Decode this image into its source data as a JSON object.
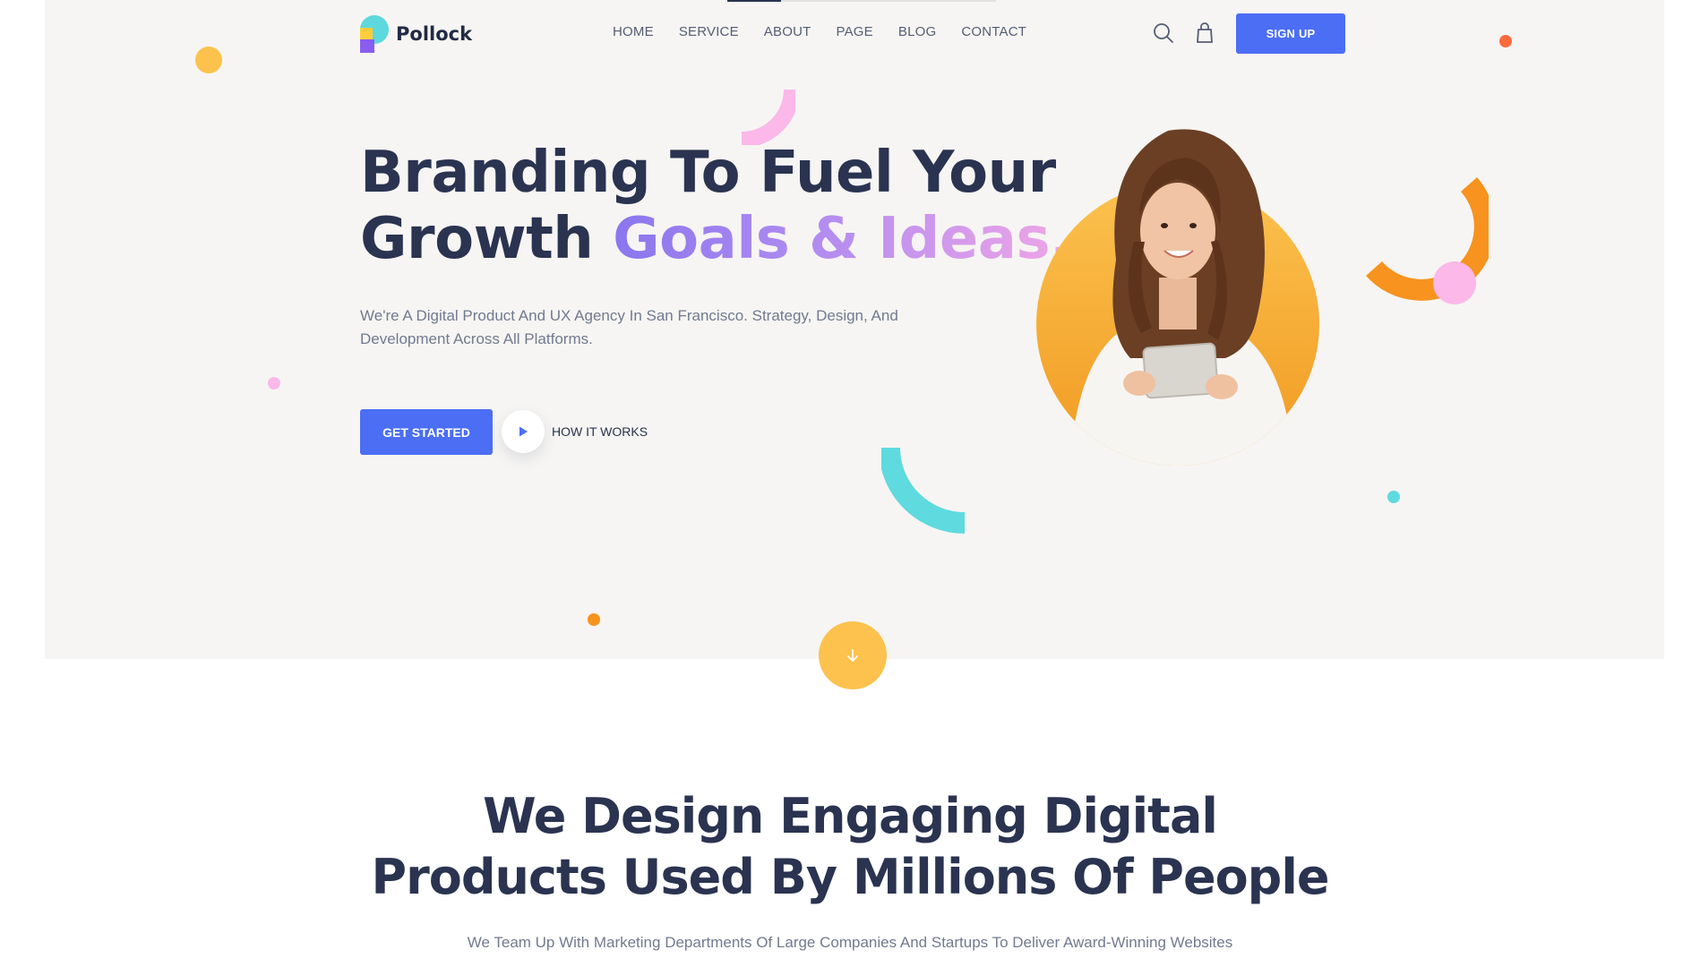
{
  "brand": {
    "name": "Pollock"
  },
  "nav": {
    "items": [
      "HOME",
      "SERVICE",
      "ABOUT",
      "PAGE",
      "BLOG",
      "CONTACT"
    ],
    "signup_label": "SIGN UP"
  },
  "hero": {
    "title_line1": "Branding To Fuel Your",
    "title_line2_plain": "Growth ",
    "title_line2_highlight": "Goals & Ideas.",
    "subtitle": "We're A Digital Product And UX Agency In San Francisco. Strategy, Design, And Development Across All Platforms.",
    "cta_label": "GET STARTED",
    "video_label": "HOW IT WORKS"
  },
  "section2": {
    "title_line1": "We Design Engaging Digital",
    "title_line2": "Products Used By Millions Of People",
    "subtitle": "We Team Up With Marketing Departments Of Large Companies And Startups To Deliver Award-Winning Websites"
  },
  "colors": {
    "primary": "#4b6ef5",
    "heading": "#2a3350",
    "hero_bg": "#f6f5f3",
    "accent_yellow": "#fcc24d",
    "accent_orange": "#f7931e",
    "accent_teal": "#5fdadf",
    "accent_pink": "#fbb8e8"
  },
  "icons": {
    "search": "search-icon",
    "bag": "shopping-bag-icon",
    "play": "play-icon",
    "scroll": "arrow-down-icon"
  }
}
